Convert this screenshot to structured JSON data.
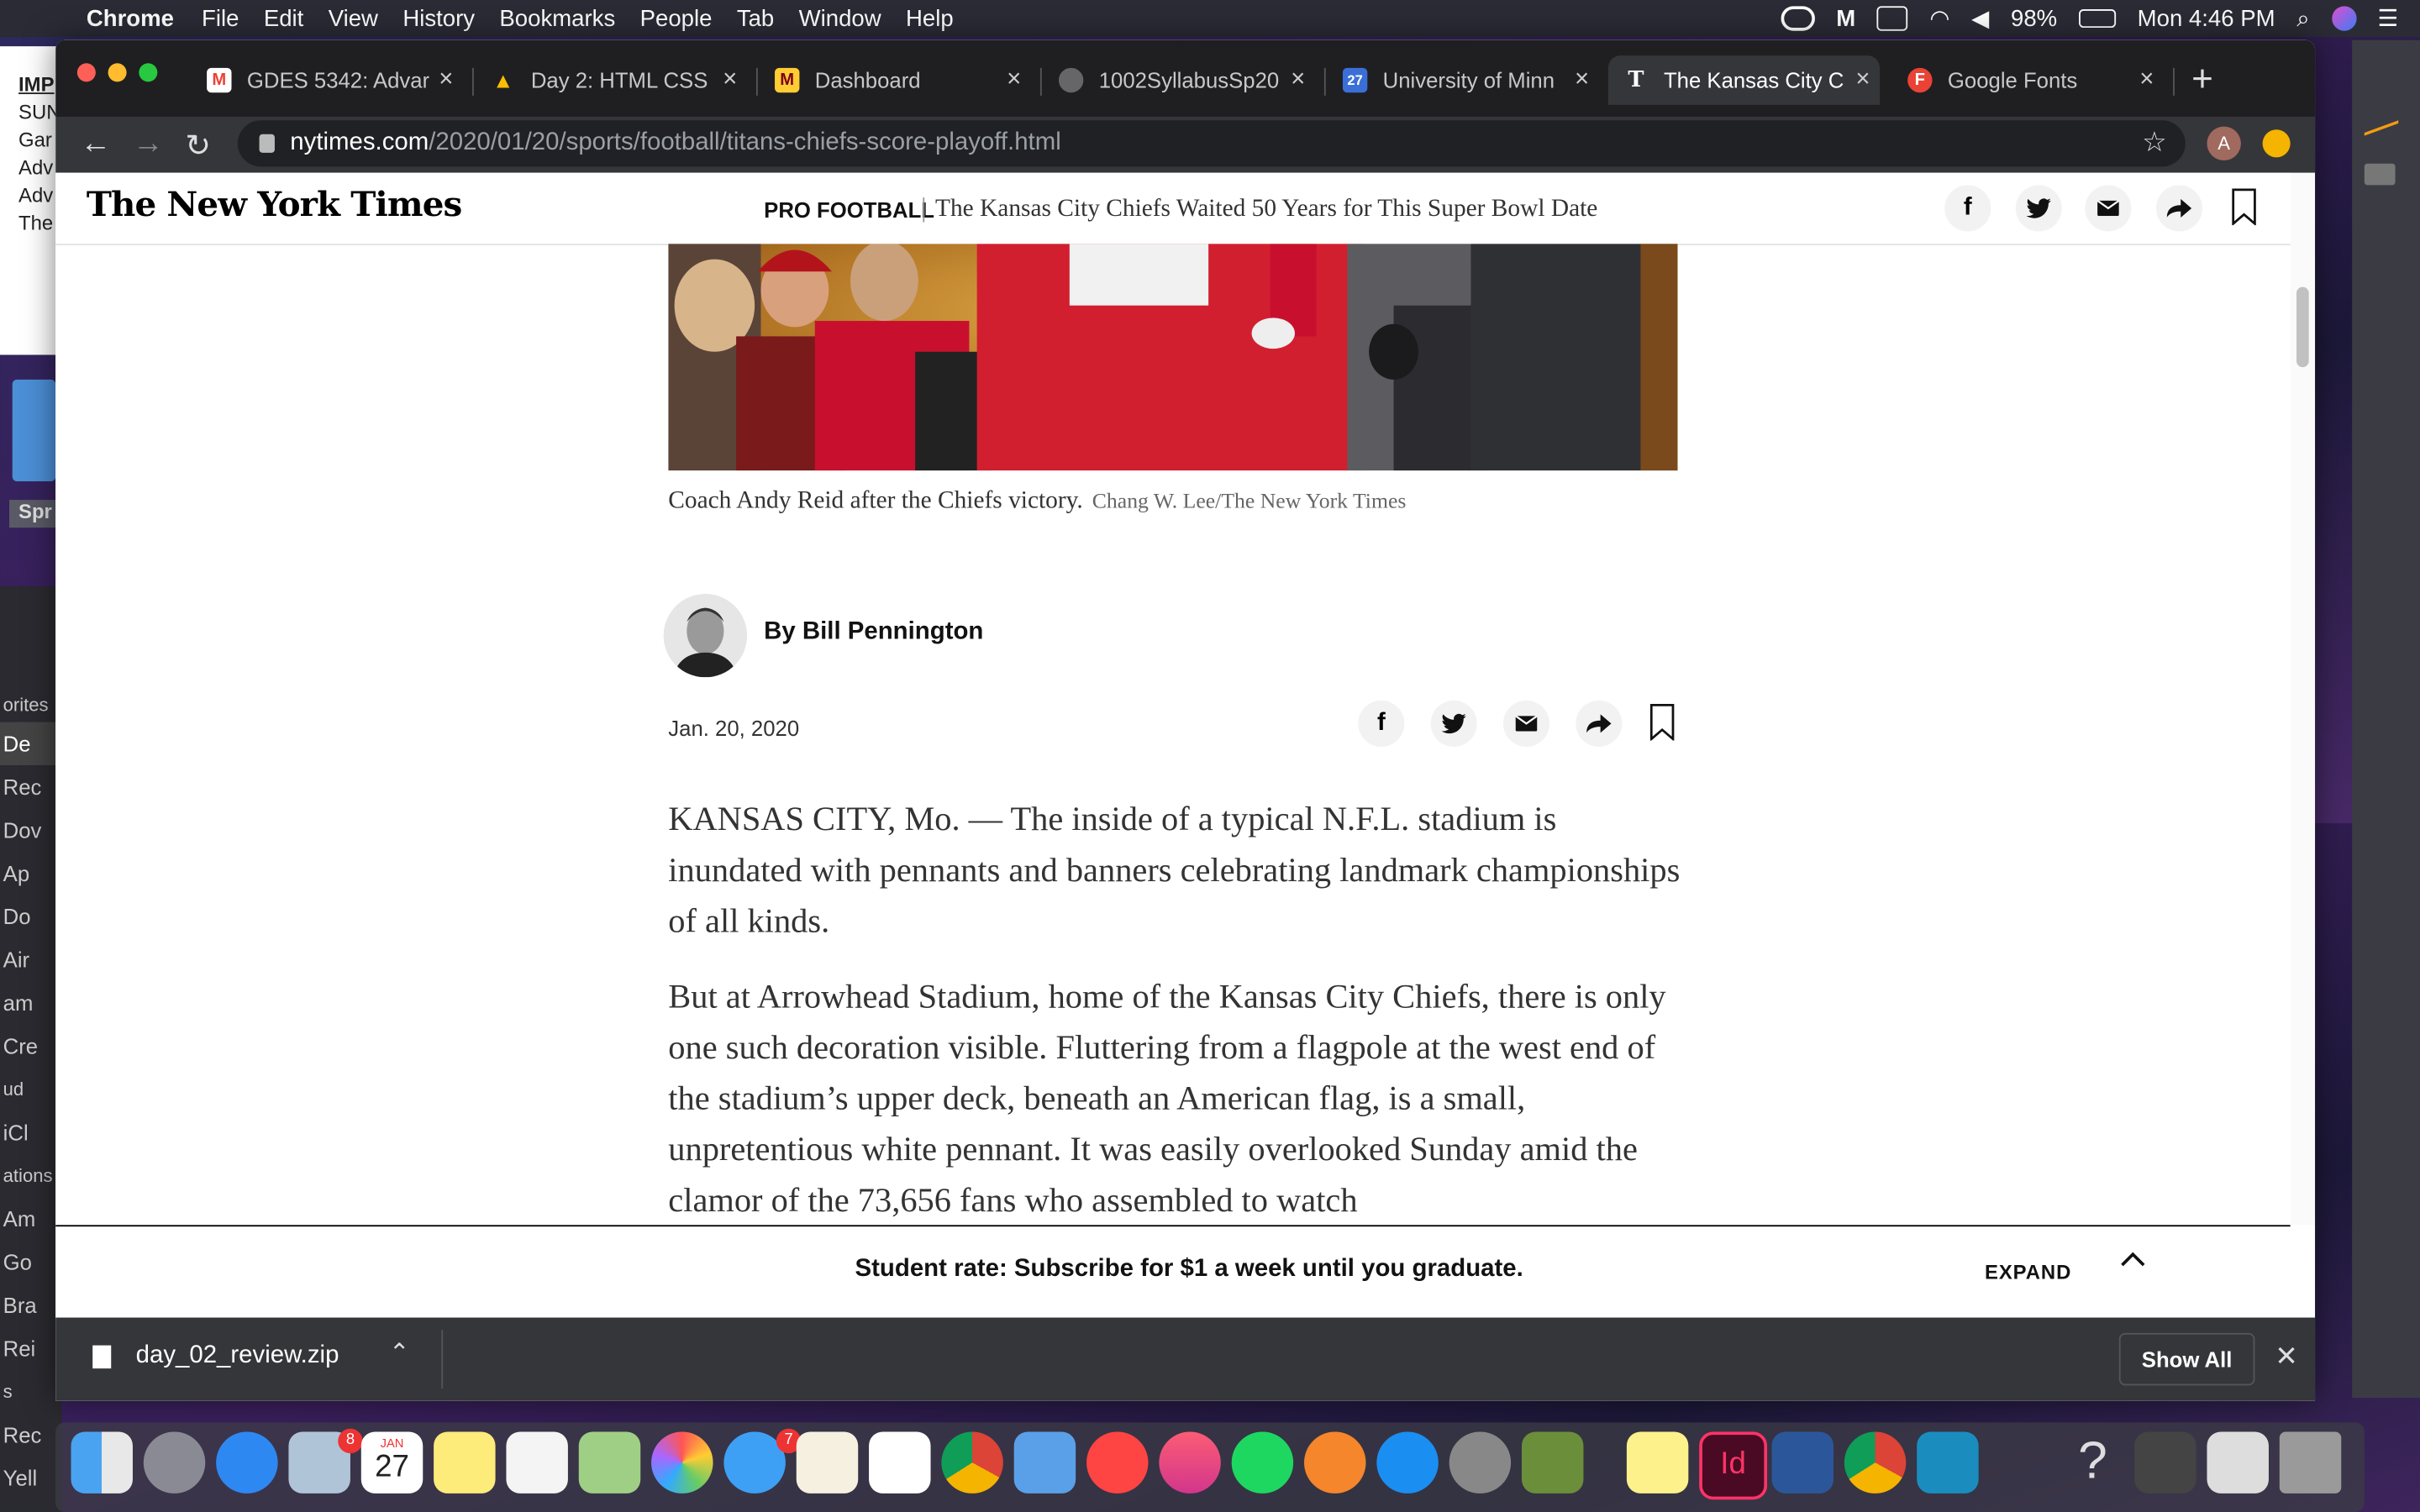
{
  "menubar": {
    "app_name": "Chrome",
    "items": [
      "File",
      "Edit",
      "View",
      "History",
      "Bookmarks",
      "People",
      "Tab",
      "Window",
      "Help"
    ],
    "battery": "98%",
    "clock": "Mon 4:46 PM"
  },
  "background_window": {
    "lines": [
      "IMP",
      "SUN",
      "",
      "Gar",
      "Adv",
      "Adv",
      "The"
    ]
  },
  "finder_sidebar": {
    "items": [
      "orites",
      "De",
      "Rec",
      "Dov",
      "Ap",
      "Do",
      "Air",
      "am",
      "Cre",
      "ud",
      "iCl",
      "ations",
      "Am",
      "Go",
      "Bra",
      "Rei",
      "s",
      "Rec",
      "Yell"
    ],
    "window_label": "Spr"
  },
  "tabs": [
    {
      "title": "GDES 5342: Advar",
      "icon": "gmail-icon",
      "color": "#ea4335",
      "glyph": "M"
    },
    {
      "title": "Day 2: HTML CSS",
      "icon": "drive-icon",
      "color": "#fbbc04",
      "glyph": "▲"
    },
    {
      "title": "Dashboard",
      "icon": "umn-icon",
      "color": "#7a0019",
      "glyph": "M"
    },
    {
      "title": "1002SyllabusSp20",
      "icon": "globe-icon",
      "color": "#777",
      "glyph": ""
    },
    {
      "title": "University of Minn",
      "icon": "calendar-icon",
      "color": "#3b6fd8",
      "glyph": "27"
    },
    {
      "title": "The Kansas City C",
      "icon": "nyt-icon",
      "color": "#35363a",
      "glyph": "T"
    },
    {
      "title": "Google Fonts",
      "icon": "google-fonts-icon",
      "color": "#ea4335",
      "glyph": "F"
    }
  ],
  "omnibox": {
    "host": "nytimes.com",
    "path": "/2020/01/20/sports/football/titans-chiefs-score-playoff.html"
  },
  "nyt": {
    "logo": "The New York Times",
    "section": "PRO FOOTBALL",
    "headline": "The Kansas City Chiefs Waited 50 Years for This Super Bowl Date",
    "caption": "Coach Andy Reid after the Chiefs victory.",
    "credit": "Chang W. Lee/The New York Times",
    "byline": "By Bill Pennington",
    "date": "Jan. 20, 2020",
    "paragraphs": [
      "KANSAS CITY, Mo. — The inside of a typical N.F.L. stadium is inundated with pennants and banners celebrating landmark championships of all kinds.",
      "But at Arrowhead Stadium, home of the Kansas City Chiefs, there is only one such decoration visible. Fluttering from a flagpole at the west end of the stadium’s upper deck, beneath an American flag, is a small, unpretentious white pennant. It was easily overlooked Sunday amid the clamor of the 73,656 fans who assembled to watch"
    ],
    "subscribe_text": "Student rate: Subscribe for $1 a week until you graduate.",
    "expand_label": "EXPAND"
  },
  "download_bar": {
    "filename": "day_02_review.zip",
    "show_all": "Show All"
  },
  "dock": {
    "calendar_month": "JAN",
    "calendar_day": "27",
    "mail_badge": "8",
    "messages_badge": "7",
    "indesign_label": "Id"
  }
}
